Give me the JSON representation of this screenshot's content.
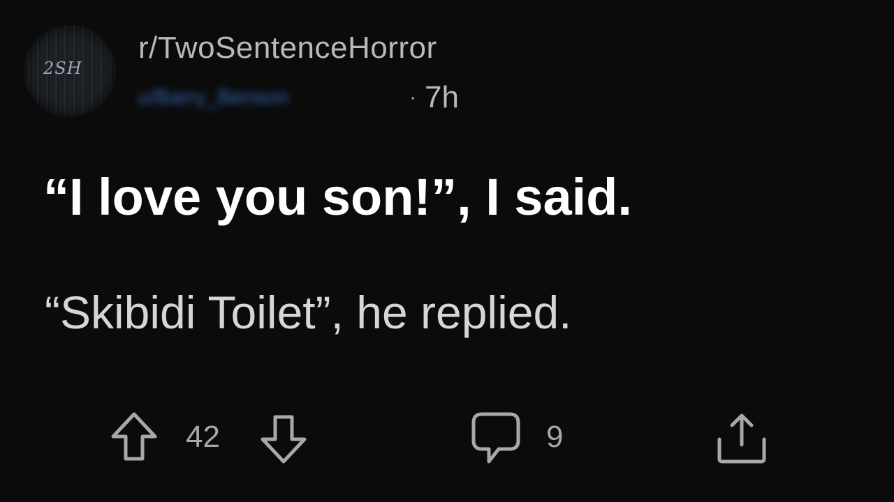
{
  "post": {
    "subreddit": "r/TwoSentenceHorror",
    "avatar_text": "2SH",
    "username": "u/Barry_Benson",
    "separator": "·",
    "age": "7h",
    "title": "“I love you son!”, I said.",
    "body": "“Skibidi Toilet”, he replied."
  },
  "actions": {
    "vote_count": "42",
    "comment_count": "9"
  },
  "icons": {
    "upvote": "arrow-up-icon",
    "downvote": "arrow-down-icon",
    "comment": "comment-bubble-icon",
    "share": "share-icon"
  },
  "colors": {
    "background": "#0b0b0c",
    "title": "#ffffff",
    "body": "#d6d6d6",
    "meta": "#b9b9bb",
    "username": "#3a74c8"
  }
}
